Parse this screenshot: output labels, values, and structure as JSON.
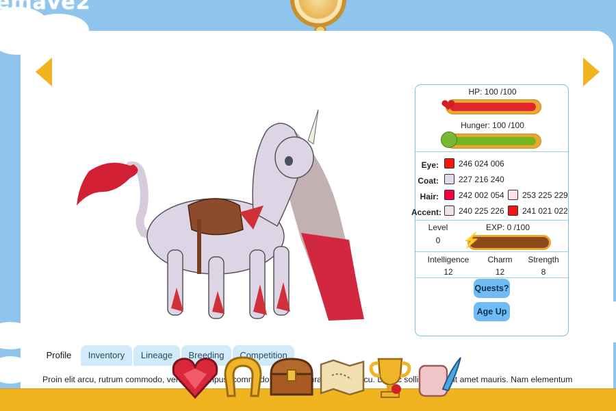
{
  "site": {
    "logo_text": "emave2"
  },
  "nav": {
    "prev_icon": "chevron-left-icon",
    "next_icon": "chevron-right-icon"
  },
  "stats": {
    "hp": {
      "label": "HP: 100 /100",
      "value": 100,
      "max": 100,
      "color": "#e0262c"
    },
    "hunger": {
      "label": "Hunger: 100 /100",
      "value": 100,
      "max": 100,
      "color": "#74b51f"
    },
    "colors": {
      "eye_label": "Eye:",
      "coat_label": "Coat:",
      "hair_label": "Hair:",
      "accent_label": "Accent:",
      "eye": [
        {
          "text": "246 024 006",
          "hex": "#f61806"
        }
      ],
      "coat": [
        {
          "text": "227 216 240",
          "hex": "#e3d8f0"
        }
      ],
      "hair": [
        {
          "text": "242 002 054",
          "hex": "#f20236"
        },
        {
          "text": "253 225 229",
          "hex": "#fde1e5"
        }
      ],
      "accent": [
        {
          "text": "240 225 226",
          "hex": "#f0e1e2"
        },
        {
          "text": "241 021 022",
          "hex": "#f11516"
        }
      ]
    },
    "level_label": "Level",
    "level_value": "0",
    "exp": {
      "label": "EXP: 0 /100",
      "value": 0,
      "max": 100,
      "color": "#e9a830"
    },
    "intelligence_label": "Intelligence",
    "intelligence_value": "12",
    "charm_label": "Charm",
    "charm_value": "12",
    "strength_label": "Strength",
    "strength_value": "8",
    "quests_button": "Quests?",
    "age_up_button": "Age Up"
  },
  "tabs": [
    {
      "label": "Profile",
      "active": true
    },
    {
      "label": "Inventory",
      "active": false
    },
    {
      "label": "Lineage",
      "active": false
    },
    {
      "label": "Breeding",
      "active": false
    },
    {
      "label": "Competition",
      "active": false
    }
  ],
  "profile_text": "Proin elit arcu, rutrum commodo, vehicula tempus, commodo a, risus. Curabitur nec arcu. Donec sollicitudin. Sit amet mauris. Nam elementum",
  "dock": {
    "items": [
      "heart-gem-icon",
      "horseshoe-icon",
      "treasure-chest-icon",
      "treasure-map-icon",
      "trophy-icon",
      "quill-scroll-icon"
    ]
  }
}
